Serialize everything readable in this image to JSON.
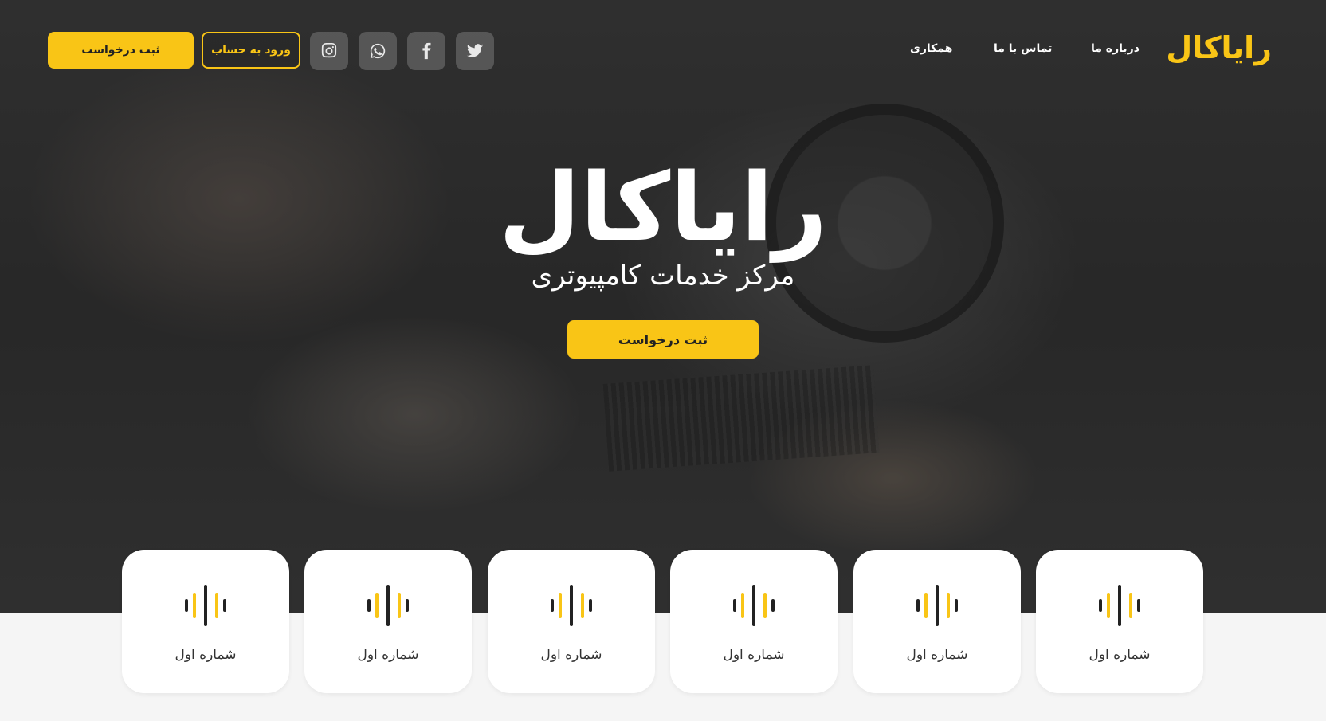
{
  "brand": {
    "logo_text": "رایاکال",
    "accent_color": "#f9c516"
  },
  "nav": {
    "items": [
      {
        "label": "درباره ما"
      },
      {
        "label": "تماس با ما"
      },
      {
        "label": "همکاری"
      }
    ]
  },
  "social": [
    {
      "icon": "twitter-icon"
    },
    {
      "icon": "facebook-icon"
    },
    {
      "icon": "whatsapp-icon"
    },
    {
      "icon": "instagram-icon"
    }
  ],
  "header_buttons": {
    "login_label": "ورود به حساب",
    "request_label": "ثبت درخواست"
  },
  "hero": {
    "title": "رایاکال",
    "subtitle": "مرکز خدمات کامپیوتری",
    "cta_label": "ثبت درخواست"
  },
  "cards": [
    {
      "label": "شماره اول",
      "icon": "sound-wave-icon"
    },
    {
      "label": "شماره اول",
      "icon": "sound-wave-icon"
    },
    {
      "label": "شماره اول",
      "icon": "sound-wave-icon"
    },
    {
      "label": "شماره اول",
      "icon": "sound-wave-icon"
    },
    {
      "label": "شماره اول",
      "icon": "sound-wave-icon"
    },
    {
      "label": "شماره اول",
      "icon": "sound-wave-icon"
    }
  ]
}
